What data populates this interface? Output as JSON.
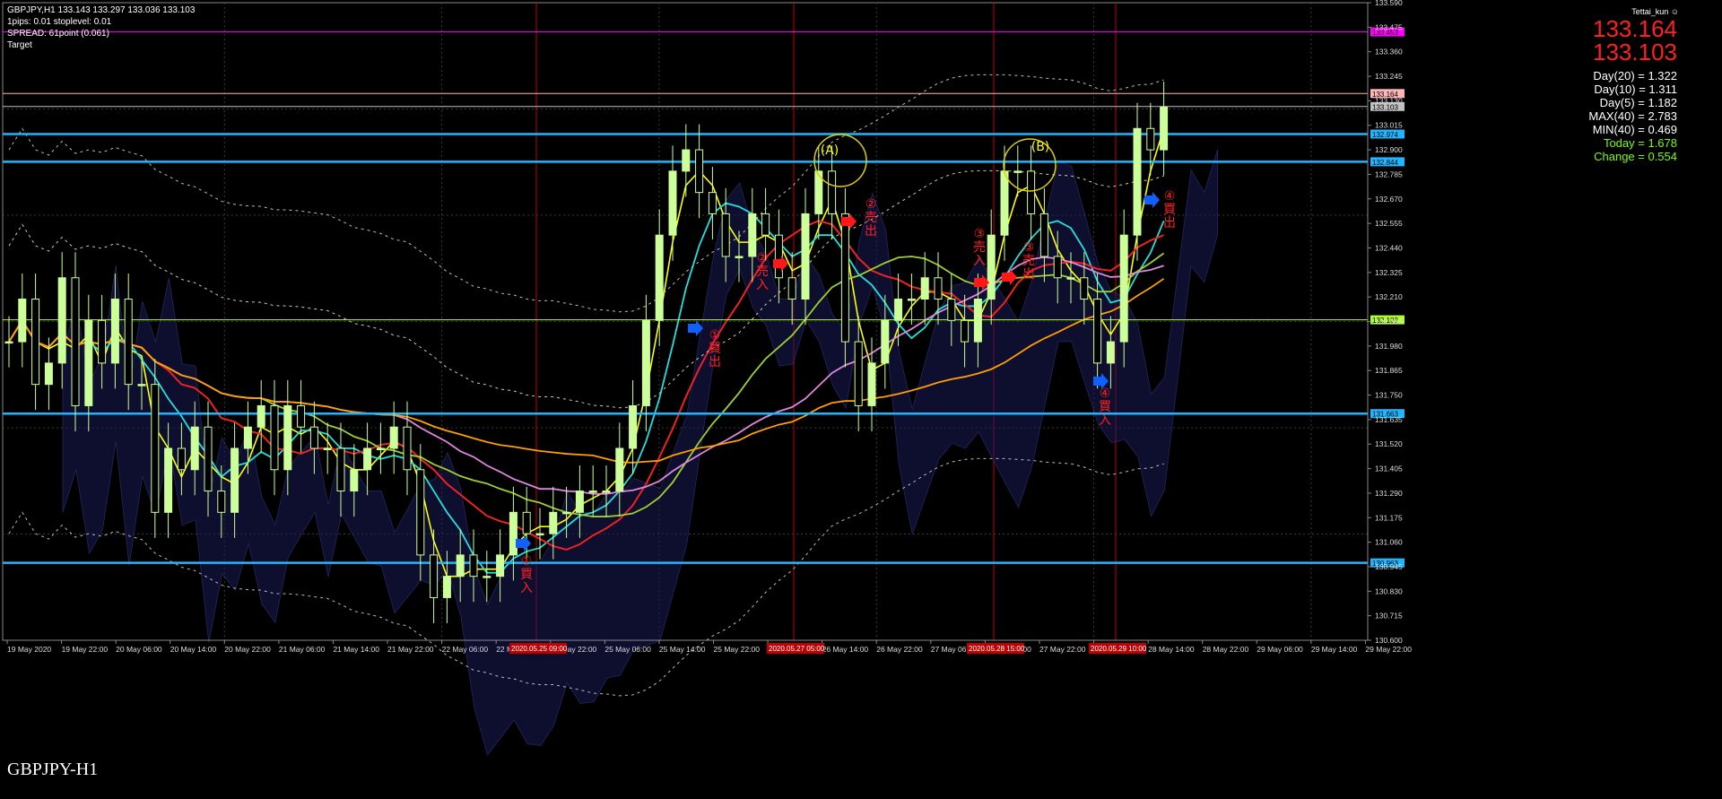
{
  "header": {
    "symbol_line": "GBPJPY,H1  133.143 133.297 133.036 133.103",
    "pips_line": "1pips: 0.01  stoplevel: 0.01",
    "spread_line": "SPREAD: 61point (0.061)",
    "target_line": "Target"
  },
  "watermark": "GBPJPY-H1",
  "user_label": "Tettai_kun",
  "prices": {
    "ask": "133.164",
    "bid": "133.103"
  },
  "stats": [
    {
      "text": "Day(20) = 1.322",
      "color": "#ffffff"
    },
    {
      "text": "Day(10) = 1.311",
      "color": "#ffffff"
    },
    {
      "text": "Day(5) = 1.182",
      "color": "#ffffff"
    },
    {
      "text": "MAX(40) = 2.783",
      "color": "#ffffff"
    },
    {
      "text": "MIN(40) = 0.469",
      "color": "#ffffff"
    },
    {
      "text": "Today = 1.678",
      "color": "#7cfc00"
    },
    {
      "text": "Change = 0.554",
      "color": "#7cfc00"
    }
  ],
  "chart_data": {
    "type": "candlestick",
    "symbol": "GBPJPY",
    "timeframe": "H1",
    "ylim": [
      130.6,
      133.59
    ],
    "y_ticks": [
      "133.590",
      "133.475",
      "133.360",
      "133.245",
      "133.130",
      "133.015",
      "132.900",
      "132.785",
      "132.670",
      "132.555",
      "132.440",
      "132.325",
      "132.210",
      "132.095",
      "131.980",
      "131.865",
      "131.750",
      "131.635",
      "131.520",
      "131.405",
      "131.290",
      "131.175",
      "131.060",
      "130.945",
      "130.830",
      "130.715",
      "130.600"
    ],
    "x_ticks": [
      "19 May 2020",
      "19 May 22:00",
      "20 May 06:00",
      "20 May 14:00",
      "20 May 22:00",
      "21 May 06:00",
      "21 May 14:00",
      "21 May 22:00",
      "22 May 06:00",
      "22 May 14:00",
      "22 May 22:00",
      "25 May 06:00",
      "25 May 14:00",
      "25 May 22:00",
      "26 May 06:00",
      "26 May 14:00",
      "26 May 22:00",
      "27 May 06:00",
      "27 May 14:00",
      "27 May 22:00",
      "28 May 06:00",
      "28 May 14:00",
      "28 May 22:00",
      "29 May 06:00",
      "29 May 14:00",
      "29 May 22:00"
    ],
    "highlighted_dates": [
      "2020.05.25 09:00",
      "2020.05.27 05:00",
      "2020.05.28 15:00",
      "2020.05.29 10:00"
    ],
    "horizontal_lines": [
      {
        "price": 133.453,
        "label": "133.453",
        "color": "#ff00ff"
      },
      {
        "price": 133.164,
        "label": "133.164",
        "color": "#ffb6b6"
      },
      {
        "price": 133.103,
        "label": "133.103",
        "color": "#c0c0c0"
      },
      {
        "price": 132.974,
        "label": "132.974",
        "color": "#1fb6ff"
      },
      {
        "price": 132.844,
        "label": "132.844",
        "color": "#1fb6ff"
      },
      {
        "price": 132.103,
        "label": "132.103",
        "color": "#adff2f"
      },
      {
        "price": 131.663,
        "label": "131.663",
        "color": "#1fb6ff"
      },
      {
        "price": 130.963,
        "label": "130.963",
        "color": "#1fb6ff"
      }
    ],
    "annotations": [
      {
        "text": "①買入",
        "color": "#ff2020"
      },
      {
        "text": "①買出",
        "color": "#ff2020"
      },
      {
        "text": "②売入",
        "color": "#ff2020"
      },
      {
        "text": "②売出",
        "color": "#ff2020"
      },
      {
        "text": "③売入",
        "color": "#ff2020"
      },
      {
        "text": "③売出",
        "color": "#ff2020"
      },
      {
        "text": "④買入",
        "color": "#ff2020"
      },
      {
        "text": "④買出",
        "color": "#ff2020"
      },
      {
        "text": "(A)",
        "color": "#ffff00"
      },
      {
        "text": "(B)",
        "color": "#ffff00"
      }
    ],
    "series": [
      {
        "name": "close",
        "values": [
          132.0,
          132.2,
          131.8,
          131.9,
          132.3,
          131.7,
          132.1,
          131.9,
          132.2,
          131.8,
          131.8,
          131.2,
          131.5,
          131.4,
          131.6,
          131.3,
          131.2,
          131.5,
          131.6,
          131.7,
          131.4,
          131.7,
          131.6,
          131.5,
          131.5,
          131.3,
          131.4,
          131.5,
          131.5,
          131.6,
          131.4,
          131.0,
          130.8,
          130.9,
          131.0,
          130.9,
          130.9,
          131.0,
          131.2,
          131.1,
          131.1,
          131.2,
          131.2,
          131.3,
          131.3,
          131.3,
          131.5,
          131.7,
          132.1,
          132.5,
          132.8,
          132.9,
          132.7,
          132.6,
          132.4,
          132.4,
          132.6,
          132.5,
          132.3,
          132.2,
          132.6,
          132.8,
          132.6,
          132.0,
          131.7,
          131.9,
          132.1,
          132.2,
          132.2,
          132.3,
          132.2,
          132.1,
          132.0,
          132.2,
          132.5,
          132.8,
          132.8,
          132.6,
          132.4,
          132.3,
          132.3,
          132.2,
          131.9,
          132.0,
          132.5,
          133.0,
          132.9,
          133.1
        ]
      }
    ]
  }
}
